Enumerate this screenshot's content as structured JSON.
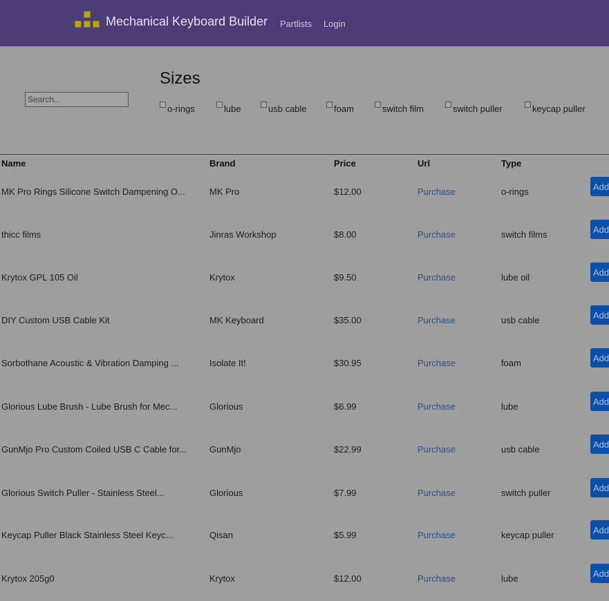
{
  "navbar": {
    "title": "Mechanical Keyboard Builder",
    "links": [
      "Partlists",
      "Login"
    ],
    "logo_icon": "keycaps-logo-icon"
  },
  "search": {
    "placeholder": "Search.."
  },
  "sizes": {
    "title": "Sizes",
    "filters": [
      "o-rings",
      "lube",
      "usb cable",
      "foam",
      "switch film",
      "switch puller",
      "keycap puller"
    ]
  },
  "table": {
    "headers": [
      "Name",
      "Brand",
      "Price",
      "Url",
      "Type"
    ],
    "add_label": "Add",
    "rows": [
      {
        "name": "MK Pro Rings Silicone Switch Dampening O...",
        "brand": "MK Pro",
        "price": "$12.00",
        "url": "Purchase",
        "type": "o-rings"
      },
      {
        "name": "thicc films",
        "brand": "Jinras Workshop",
        "price": "$8.00",
        "url": "Purchase",
        "type": "switch films"
      },
      {
        "name": "Krytox GPL 105 Oil",
        "brand": "Krytox",
        "price": "$9.50",
        "url": "Purchase",
        "type": "lube oil"
      },
      {
        "name": "DIY Custom USB Cable Kit",
        "brand": "MK Keyboard",
        "price": "$35.00",
        "url": "Purchase",
        "type": "usb cable"
      },
      {
        "name": "Sorbothane Acoustic & Vibration Damping ...",
        "brand": "Isolate It!",
        "price": "$30.95",
        "url": "Purchase",
        "type": "foam"
      },
      {
        "name": "Glorious Lube Brush - Lube Brush for Mec...",
        "brand": "Glorious",
        "price": "$6.99",
        "url": "Purchase",
        "type": "lube"
      },
      {
        "name": "GunMjo Pro Custom Coiled USB C Cable for...",
        "brand": "GunMjo",
        "price": "$22.99",
        "url": "Purchase",
        "type": "usb cable"
      },
      {
        "name": "Glorious Switch Puller - Stainless Steel...",
        "brand": "Glorious",
        "price": "$7.99",
        "url": "Purchase",
        "type": "switch puller"
      },
      {
        "name": "Keycap Puller Black Stainless Steel Keyc...",
        "brand": "Qisan",
        "price": "$5.99",
        "url": "Purchase",
        "type": "keycap puller"
      },
      {
        "name": "Krytox 205g0",
        "brand": "Krytox",
        "price": "$12.00",
        "url": "Purchase",
        "type": "lube"
      }
    ]
  },
  "colors": {
    "navbar_bg": "#4b3c78",
    "overlay_bg": "#9e9e9e",
    "button_bg": "#0b4fa8",
    "link": "#2a4f8a"
  }
}
